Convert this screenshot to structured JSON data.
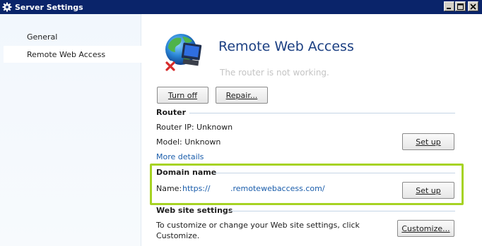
{
  "window": {
    "title": "Server Settings",
    "icon": "gear-icon",
    "controls": [
      "minimize-icon",
      "maximize-icon",
      "close-icon"
    ]
  },
  "sidebar": {
    "items": [
      {
        "label": "General",
        "selected": false
      },
      {
        "label": "Remote Web Access",
        "selected": true
      }
    ]
  },
  "header": {
    "title": "Remote Web Access",
    "status": "The router is not working.",
    "icon": "globe-error-icon"
  },
  "actions": {
    "turn_off_label": "Turn off",
    "repair_label": "Repair..."
  },
  "router": {
    "heading": "Router",
    "ip_text": "Router IP: Unknown",
    "model_text": "Model: Unknown",
    "more_details_label": "More details",
    "setup_label": "Set up"
  },
  "domain": {
    "heading": "Domain name",
    "name_label": "Name:",
    "name_prefix": "https://",
    "name_suffix": ".remotewebaccess.com/",
    "setup_label": "Set up"
  },
  "website": {
    "heading": "Web site settings",
    "description_line1": "To customize or change your Web site settings, click",
    "description_line2": "Customize.",
    "customize_label": "Customize..."
  },
  "colors": {
    "titlebar": "#0a246a",
    "accent_title": "#1b3f82",
    "link": "#1a5dab",
    "highlight": "#a6d323"
  }
}
